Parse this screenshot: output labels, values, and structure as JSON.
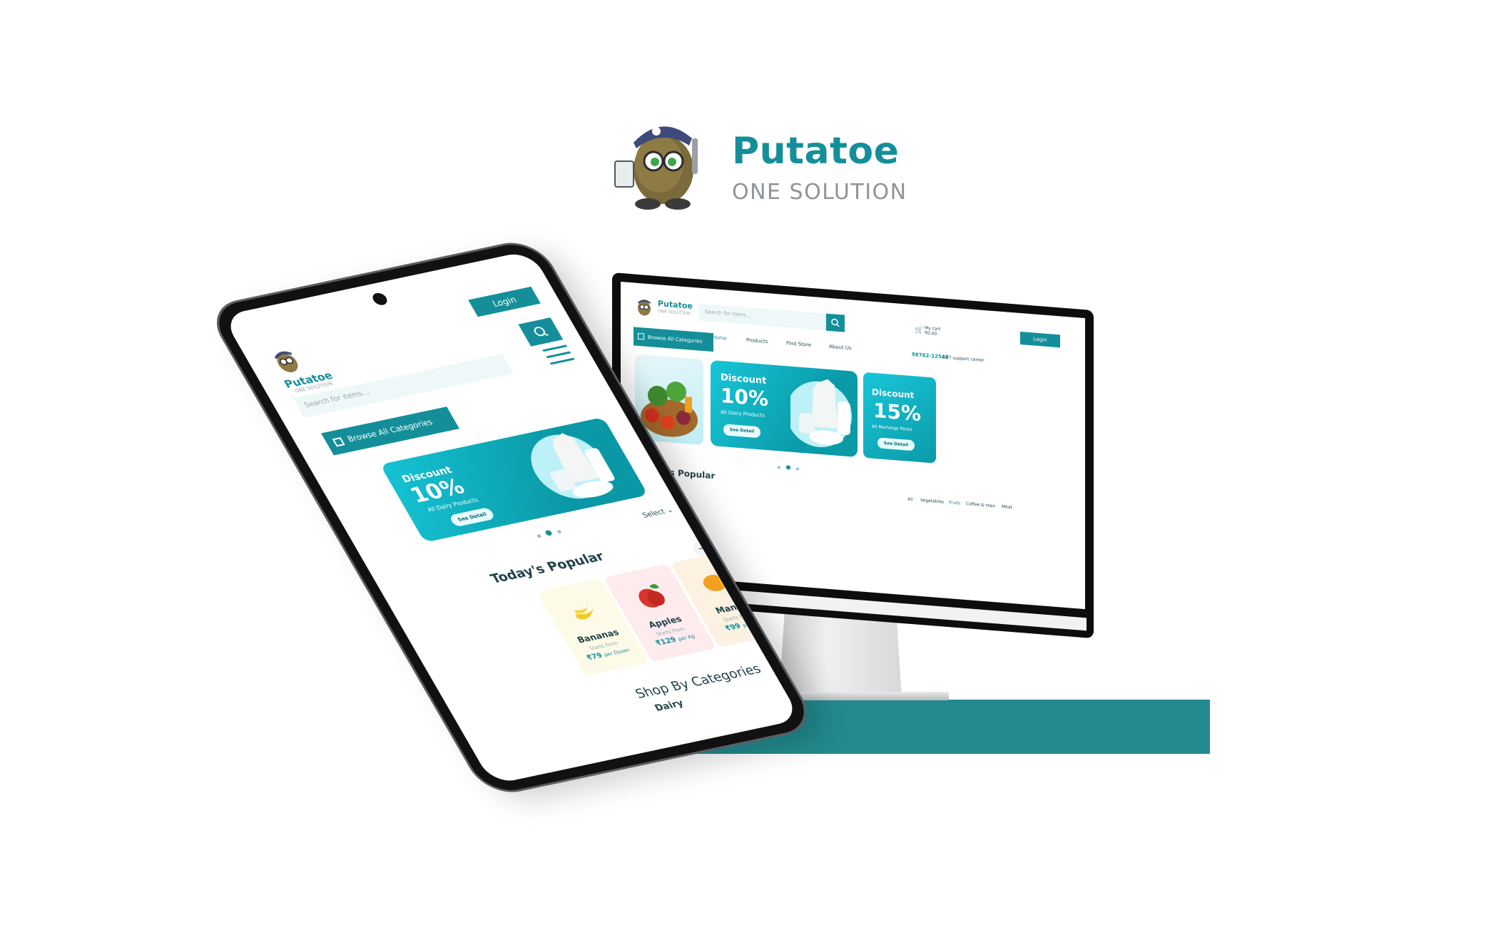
{
  "brand": {
    "title": "Putatoe",
    "subtitle": "ONE SOLUTION"
  },
  "desktop": {
    "logo_name": "Putatoe",
    "logo_tag": "ONE SOLUTION",
    "search_placeholder": "Search for items...",
    "cart_label": "My cart",
    "cart_amount": "₹0.00",
    "login_label": "Login",
    "browse_label": "Browse All Categories",
    "nav": [
      "Home",
      "Products",
      "Find Store",
      "About Us"
    ],
    "support_phone": "98762-12542",
    "support_text": "24/7 support center",
    "banners": [
      {
        "title": "Discount",
        "percent": "10%",
        "subtitle": "All Dairy Products",
        "button": "See Detail"
      },
      {
        "title": "Discount",
        "percent": "15%",
        "subtitle": "All Recharge Packs",
        "button": "See Detail"
      }
    ],
    "popular_title": "Today's Popular",
    "filters": [
      "All",
      "Vegetables",
      "Fruits",
      "Coffee & teas",
      "Meat"
    ]
  },
  "mobile": {
    "login_label": "Login",
    "logo_name": "Putatoe",
    "logo_tag": "ONE SOLUTION",
    "search_placeholder": "Search for items...",
    "browse_label": "Browse All Categories",
    "banner": {
      "title": "Discount",
      "percent": "10%",
      "subtitle": "All Dairy Products",
      "button": "See Detail"
    },
    "select_label": "Select",
    "popular_title": "Today's Popular",
    "products": [
      {
        "name": "Bananas",
        "starts": "Starts From",
        "price": "₹79",
        "unit": "per Dozen"
      },
      {
        "name": "Apples",
        "starts": "Starts From",
        "price": "₹129",
        "unit": "per Kg"
      },
      {
        "name": "Mango",
        "starts": "Starts From",
        "price": "₹99",
        "unit": "per Kg"
      }
    ],
    "view_more": "View More →",
    "shop_title": "Shop By Categories",
    "category": "Dairy"
  },
  "colors": {
    "accent": "#148f9a",
    "stand": "#238a8f",
    "text_dark": "#22434b"
  }
}
